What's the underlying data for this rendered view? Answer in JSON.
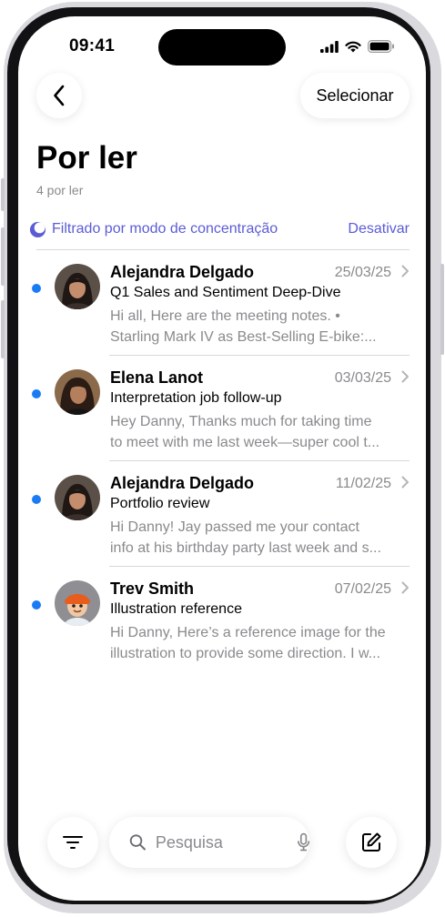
{
  "status_bar": {
    "time": "09:41"
  },
  "nav": {
    "back_icon": "chevron-left-icon",
    "select_label": "Selecionar"
  },
  "mailbox": {
    "title": "Por ler",
    "subtitle": "4 por ler"
  },
  "focus_filter": {
    "icon": "moon-icon",
    "text": "Filtrado por modo de concentração",
    "action_label": "Desativar"
  },
  "messages": [
    {
      "sender": "Alejandra Delgado",
      "date": "25/03/25",
      "subject": "Q1 Sales and Sentiment Deep-Dive",
      "preview_line1": "Hi all, Here are the meeting notes. •",
      "preview_line2": "Starling Mark IV as Best-Selling E-bike:...",
      "unread": true
    },
    {
      "sender": "Elena Lanot",
      "date": "03/03/25",
      "subject": "Interpretation job follow-up",
      "preview_line1": "Hey Danny, Thanks much for taking time",
      "preview_line2": "to meet with me last week—super cool t...",
      "unread": true
    },
    {
      "sender": "Alejandra Delgado",
      "date": "11/02/25",
      "subject": "Portfolio review",
      "preview_line1": "Hi Danny! Jay passed me your contact",
      "preview_line2": "info at his birthday party last week and s...",
      "unread": true
    },
    {
      "sender": "Trev Smith",
      "date": "07/02/25",
      "subject": "Illustration reference",
      "preview_line1": "Hi Danny, Here’s a reference image for the",
      "preview_line2": "illustration to provide some direction. I w...",
      "unread": true
    }
  ],
  "bottom_bar": {
    "filter_icon": "filter-lines-icon",
    "search_placeholder": "Pesquisa",
    "search_icon": "magnifier-icon",
    "mic_icon": "microphone-icon",
    "compose_icon": "compose-icon"
  },
  "colors": {
    "accent": "#5b5bd6",
    "unread_dot": "#1a7cf5",
    "secondary_text": "#8a8a8e"
  }
}
